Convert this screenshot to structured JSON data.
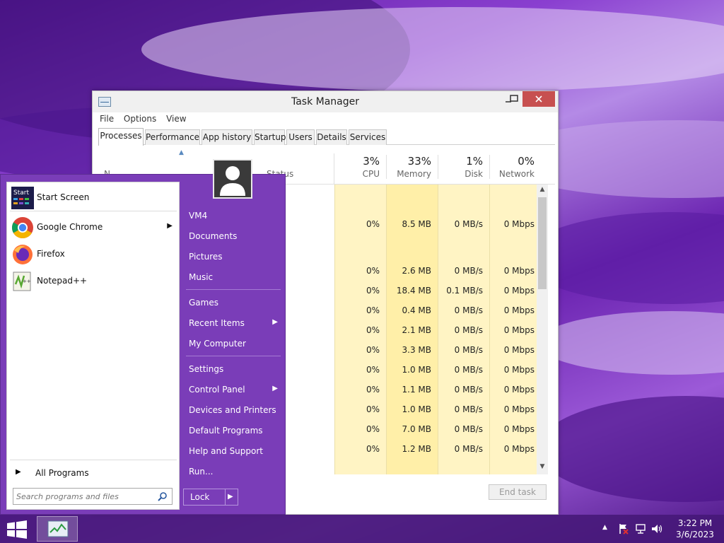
{
  "taskmanager": {
    "title": "Task Manager",
    "menu": [
      "File",
      "Options",
      "View"
    ],
    "tabs": [
      "Processes",
      "Performance",
      "App history",
      "Startup",
      "Users",
      "Details",
      "Services"
    ],
    "active_tab": "Processes",
    "columns": [
      {
        "pct": "3%",
        "label": "CPU"
      },
      {
        "pct": "33%",
        "label": "Memory"
      },
      {
        "pct": "1%",
        "label": "Disk"
      },
      {
        "pct": "0%",
        "label": "Network"
      }
    ],
    "partial_headers": {
      "name": "N",
      "status": "Status"
    },
    "rows": [
      [
        "0%",
        "8.5 MB",
        "0 MB/s",
        "0 Mbps"
      ],
      [
        "0%",
        "2.6 MB",
        "0 MB/s",
        "0 Mbps"
      ],
      [
        "0%",
        "18.4 MB",
        "0.1 MB/s",
        "0 Mbps"
      ],
      [
        "0%",
        "0.4 MB",
        "0 MB/s",
        "0 Mbps"
      ],
      [
        "0%",
        "2.1 MB",
        "0 MB/s",
        "0 Mbps"
      ],
      [
        "0%",
        "3.3 MB",
        "0 MB/s",
        "0 Mbps"
      ],
      [
        "0%",
        "1.0 MB",
        "0 MB/s",
        "0 Mbps"
      ],
      [
        "0%",
        "1.1 MB",
        "0 MB/s",
        "0 Mbps"
      ],
      [
        "0%",
        "1.0 MB",
        "0 MB/s",
        "0 Mbps"
      ],
      [
        "0%",
        "7.0 MB",
        "0 MB/s",
        "0 Mbps"
      ],
      [
        "0%",
        "1.2 MB",
        "0 MB/s",
        "0 Mbps"
      ]
    ],
    "end_task": "End task"
  },
  "startmenu": {
    "pinned": [
      {
        "label": "Start Screen",
        "icon": "start-screen-icon"
      },
      {
        "label": "Google Chrome",
        "icon": "chrome-icon",
        "submenu": true
      },
      {
        "label": "Firefox",
        "icon": "firefox-icon"
      },
      {
        "label": "Notepad++",
        "icon": "notepadpp-icon"
      }
    ],
    "start_screen_icon_text": "Start",
    "all_programs": "All Programs",
    "search_placeholder": "Search programs and files",
    "right_items": [
      {
        "label": "VM4"
      },
      {
        "label": "Documents"
      },
      {
        "label": "Pictures"
      },
      {
        "label": "Music"
      },
      {
        "label": "Games"
      },
      {
        "label": "Recent Items",
        "submenu": true
      },
      {
        "label": "My Computer"
      },
      {
        "label": "Settings"
      },
      {
        "label": "Control Panel",
        "submenu": true
      },
      {
        "label": "Devices and Printers"
      },
      {
        "label": "Default Programs"
      },
      {
        "label": "Help and Support"
      },
      {
        "label": "Run..."
      }
    ],
    "lock_label": "Lock"
  },
  "taskbar": {
    "time": "3:22 PM",
    "date": "3/6/2023"
  },
  "colors": {
    "accent": "#7a3db8",
    "column_highlight": "#fff4c4",
    "close_button": "#c75050"
  }
}
